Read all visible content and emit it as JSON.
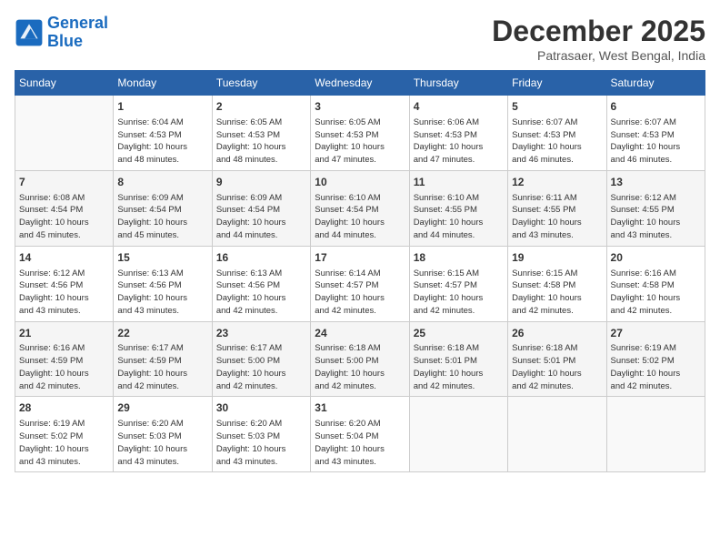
{
  "header": {
    "logo_line1": "General",
    "logo_line2": "Blue",
    "month_title": "December 2025",
    "location": "Patrasaer, West Bengal, India"
  },
  "weekdays": [
    "Sunday",
    "Monday",
    "Tuesday",
    "Wednesday",
    "Thursday",
    "Friday",
    "Saturday"
  ],
  "weeks": [
    [
      {
        "day": "",
        "info": ""
      },
      {
        "day": "1",
        "info": "Sunrise: 6:04 AM\nSunset: 4:53 PM\nDaylight: 10 hours\nand 48 minutes."
      },
      {
        "day": "2",
        "info": "Sunrise: 6:05 AM\nSunset: 4:53 PM\nDaylight: 10 hours\nand 48 minutes."
      },
      {
        "day": "3",
        "info": "Sunrise: 6:05 AM\nSunset: 4:53 PM\nDaylight: 10 hours\nand 47 minutes."
      },
      {
        "day": "4",
        "info": "Sunrise: 6:06 AM\nSunset: 4:53 PM\nDaylight: 10 hours\nand 47 minutes."
      },
      {
        "day": "5",
        "info": "Sunrise: 6:07 AM\nSunset: 4:53 PM\nDaylight: 10 hours\nand 46 minutes."
      },
      {
        "day": "6",
        "info": "Sunrise: 6:07 AM\nSunset: 4:53 PM\nDaylight: 10 hours\nand 46 minutes."
      }
    ],
    [
      {
        "day": "7",
        "info": "Sunrise: 6:08 AM\nSunset: 4:54 PM\nDaylight: 10 hours\nand 45 minutes."
      },
      {
        "day": "8",
        "info": "Sunrise: 6:09 AM\nSunset: 4:54 PM\nDaylight: 10 hours\nand 45 minutes."
      },
      {
        "day": "9",
        "info": "Sunrise: 6:09 AM\nSunset: 4:54 PM\nDaylight: 10 hours\nand 44 minutes."
      },
      {
        "day": "10",
        "info": "Sunrise: 6:10 AM\nSunset: 4:54 PM\nDaylight: 10 hours\nand 44 minutes."
      },
      {
        "day": "11",
        "info": "Sunrise: 6:10 AM\nSunset: 4:55 PM\nDaylight: 10 hours\nand 44 minutes."
      },
      {
        "day": "12",
        "info": "Sunrise: 6:11 AM\nSunset: 4:55 PM\nDaylight: 10 hours\nand 43 minutes."
      },
      {
        "day": "13",
        "info": "Sunrise: 6:12 AM\nSunset: 4:55 PM\nDaylight: 10 hours\nand 43 minutes."
      }
    ],
    [
      {
        "day": "14",
        "info": "Sunrise: 6:12 AM\nSunset: 4:56 PM\nDaylight: 10 hours\nand 43 minutes."
      },
      {
        "day": "15",
        "info": "Sunrise: 6:13 AM\nSunset: 4:56 PM\nDaylight: 10 hours\nand 43 minutes."
      },
      {
        "day": "16",
        "info": "Sunrise: 6:13 AM\nSunset: 4:56 PM\nDaylight: 10 hours\nand 42 minutes."
      },
      {
        "day": "17",
        "info": "Sunrise: 6:14 AM\nSunset: 4:57 PM\nDaylight: 10 hours\nand 42 minutes."
      },
      {
        "day": "18",
        "info": "Sunrise: 6:15 AM\nSunset: 4:57 PM\nDaylight: 10 hours\nand 42 minutes."
      },
      {
        "day": "19",
        "info": "Sunrise: 6:15 AM\nSunset: 4:58 PM\nDaylight: 10 hours\nand 42 minutes."
      },
      {
        "day": "20",
        "info": "Sunrise: 6:16 AM\nSunset: 4:58 PM\nDaylight: 10 hours\nand 42 minutes."
      }
    ],
    [
      {
        "day": "21",
        "info": "Sunrise: 6:16 AM\nSunset: 4:59 PM\nDaylight: 10 hours\nand 42 minutes."
      },
      {
        "day": "22",
        "info": "Sunrise: 6:17 AM\nSunset: 4:59 PM\nDaylight: 10 hours\nand 42 minutes."
      },
      {
        "day": "23",
        "info": "Sunrise: 6:17 AM\nSunset: 5:00 PM\nDaylight: 10 hours\nand 42 minutes."
      },
      {
        "day": "24",
        "info": "Sunrise: 6:18 AM\nSunset: 5:00 PM\nDaylight: 10 hours\nand 42 minutes."
      },
      {
        "day": "25",
        "info": "Sunrise: 6:18 AM\nSunset: 5:01 PM\nDaylight: 10 hours\nand 42 minutes."
      },
      {
        "day": "26",
        "info": "Sunrise: 6:18 AM\nSunset: 5:01 PM\nDaylight: 10 hours\nand 42 minutes."
      },
      {
        "day": "27",
        "info": "Sunrise: 6:19 AM\nSunset: 5:02 PM\nDaylight: 10 hours\nand 42 minutes."
      }
    ],
    [
      {
        "day": "28",
        "info": "Sunrise: 6:19 AM\nSunset: 5:02 PM\nDaylight: 10 hours\nand 43 minutes."
      },
      {
        "day": "29",
        "info": "Sunrise: 6:20 AM\nSunset: 5:03 PM\nDaylight: 10 hours\nand 43 minutes."
      },
      {
        "day": "30",
        "info": "Sunrise: 6:20 AM\nSunset: 5:03 PM\nDaylight: 10 hours\nand 43 minutes."
      },
      {
        "day": "31",
        "info": "Sunrise: 6:20 AM\nSunset: 5:04 PM\nDaylight: 10 hours\nand 43 minutes."
      },
      {
        "day": "",
        "info": ""
      },
      {
        "day": "",
        "info": ""
      },
      {
        "day": "",
        "info": ""
      }
    ]
  ]
}
